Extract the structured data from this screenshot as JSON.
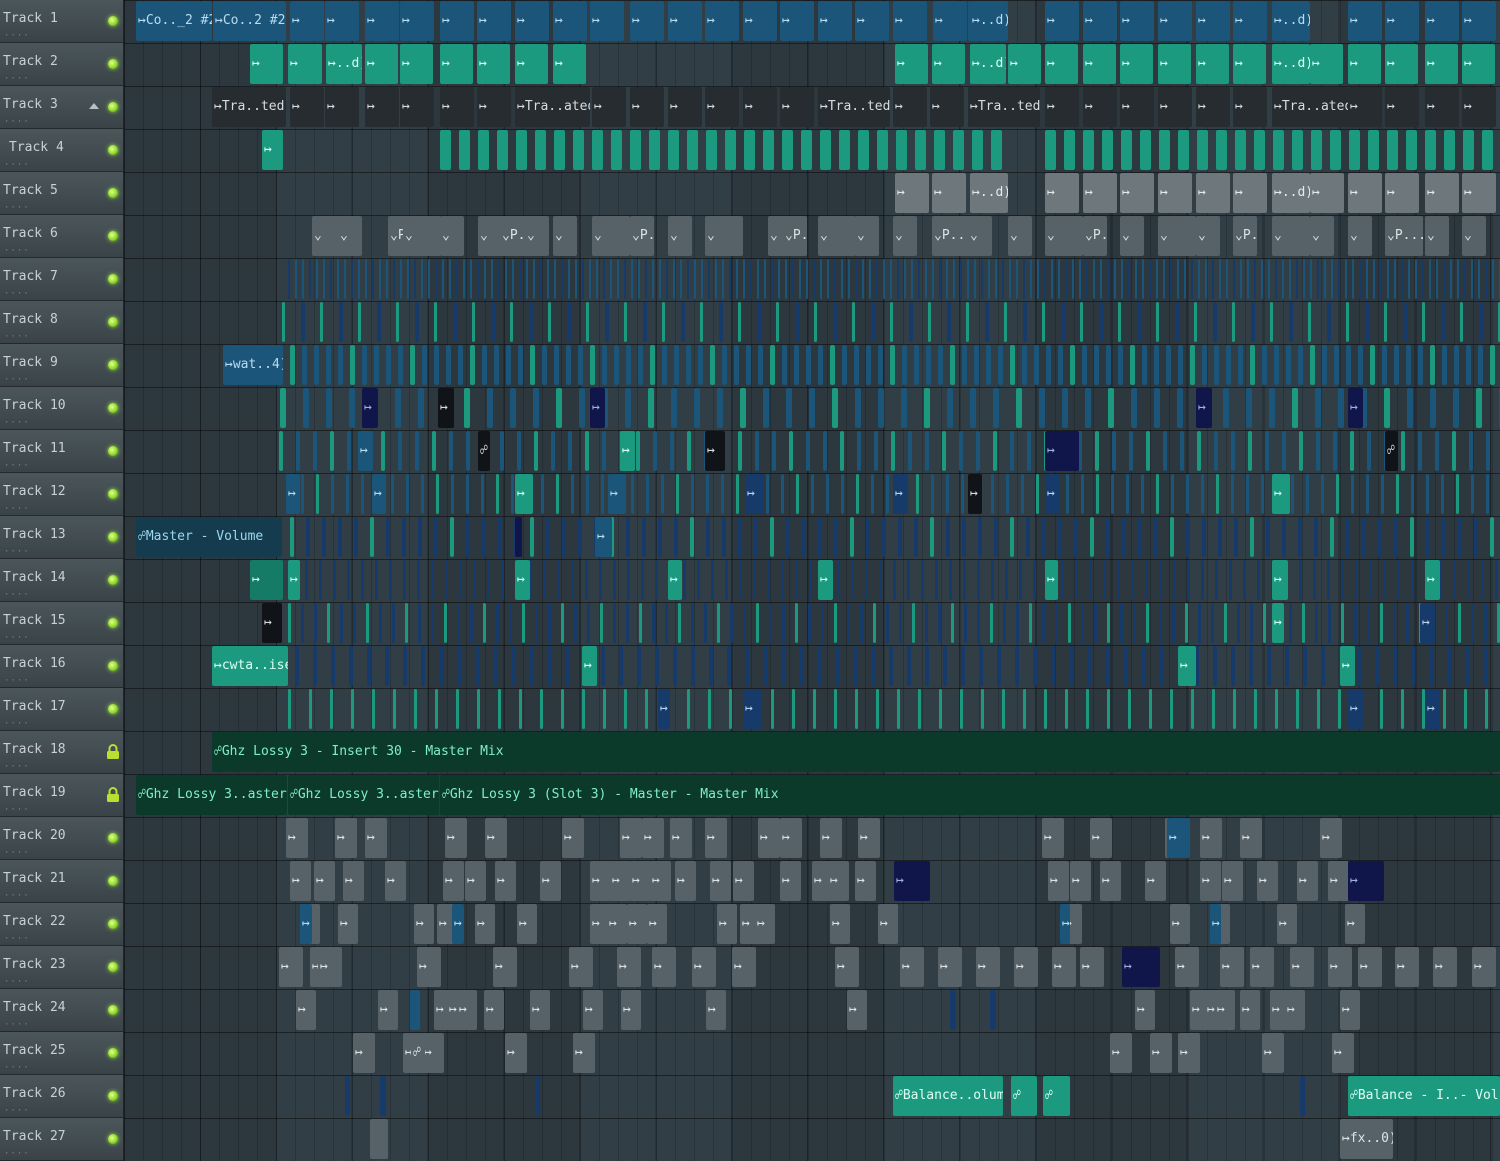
{
  "tracks": [
    {
      "name": "Track 1",
      "indicator": "led"
    },
    {
      "name": "Track 2",
      "indicator": "led"
    },
    {
      "name": "Track 3",
      "indicator": "led",
      "expanded_arrow": true
    },
    {
      "name": "Track 4",
      "indicator": "led"
    },
    {
      "name": "Track 5",
      "indicator": "led"
    },
    {
      "name": "Track 6",
      "indicator": "led"
    },
    {
      "name": "Track 7",
      "indicator": "led"
    },
    {
      "name": "Track 8",
      "indicator": "led"
    },
    {
      "name": "Track 9",
      "indicator": "led"
    },
    {
      "name": "Track 10",
      "indicator": "led"
    },
    {
      "name": "Track 11",
      "indicator": "led"
    },
    {
      "name": "Track 12",
      "indicator": "led"
    },
    {
      "name": "Track 13",
      "indicator": "led"
    },
    {
      "name": "Track 14",
      "indicator": "led"
    },
    {
      "name": "Track 15",
      "indicator": "led"
    },
    {
      "name": "Track 16",
      "indicator": "led"
    },
    {
      "name": "Track 17",
      "indicator": "led"
    },
    {
      "name": "Track 18",
      "indicator": "lock"
    },
    {
      "name": "Track 19",
      "indicator": "lock"
    },
    {
      "name": "Track 20",
      "indicator": "led"
    },
    {
      "name": "Track 21",
      "indicator": "led"
    },
    {
      "name": "Track 22",
      "indicator": "led"
    },
    {
      "name": "Track 23",
      "indicator": "led"
    },
    {
      "name": "Track 24",
      "indicator": "led"
    },
    {
      "name": "Track 25",
      "indicator": "led"
    },
    {
      "name": "Track 26",
      "indicator": "led"
    },
    {
      "name": "Track 27",
      "indicator": "led"
    }
  ],
  "clips": {
    "row1_a": "Co.._2 #2",
    "row1_b": "Co..2 #2",
    "row1_c": "..d)",
    "row1_d": "..d)",
    "row2_a": "..d)",
    "row2_b": "..d)",
    "row2_c": "..d)",
    "row3_a": "Tra..ted)",
    "row3_b": "Tra..ated)",
    "row3_c": "Tra..ted)",
    "row3_d": "Tra..ted)",
    "row3_e": "Tra..ated)",
    "row5_a": "..d)",
    "row5_b": "..d)",
    "row6_p": "P...",
    "row9_a": "wat..4)",
    "row13_a": "Master - Volume",
    "row16_a": "cwta..iser",
    "row18_a": "Ghz Lossy 3 - Insert 30 - Master Mix",
    "row19_a": "Ghz Lossy 3..aster Mix",
    "row19_b": "Ghz Lossy 3..aster Mix",
    "row19_c": "Ghz Lossy 3 (Slot 3) - Master - Master Mix",
    "row26_a": "Balance..olume",
    "row26_b": "Balance - I..- Volume",
    "row27_a": "fx..0)"
  },
  "icons": {
    "pattern_clip": "pattern-clip-icon",
    "automation_clip": "automation-clip-icon",
    "audio_clip": "audio-clip-icon",
    "led": "track-enabled-led-icon",
    "lock": "track-locked-icon"
  },
  "colors": {
    "background": "#2c3a42",
    "teal_clip": "#1c9a80",
    "blue_clip": "#1b5579",
    "gray_clip": "#566168",
    "automation_clip": "#0c3a2a",
    "led": "#8cd92c"
  }
}
